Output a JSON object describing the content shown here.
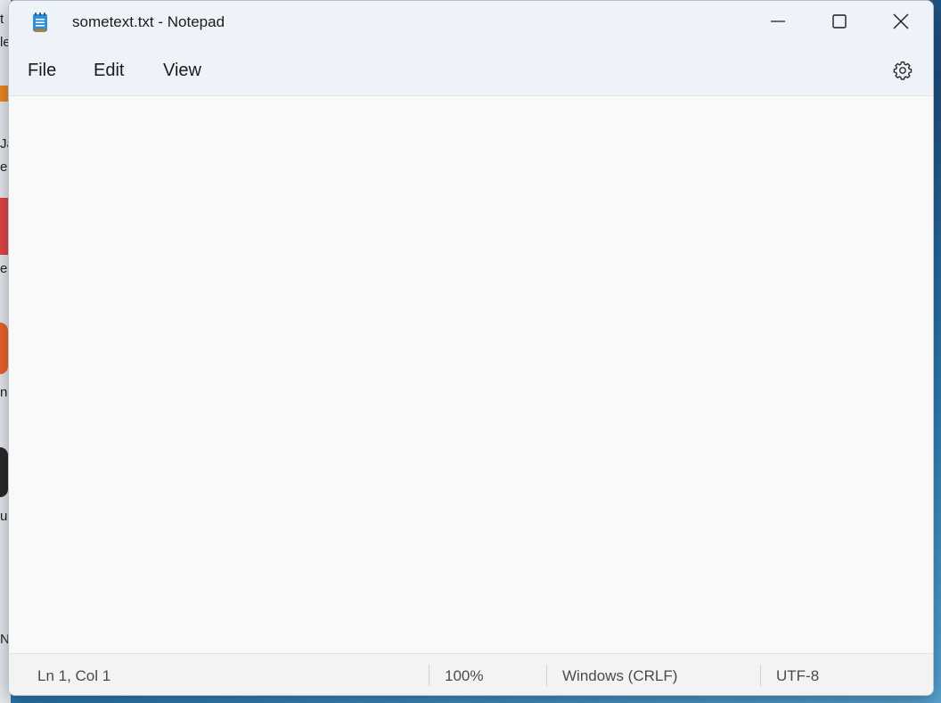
{
  "window": {
    "title": "sometext.txt - Notepad",
    "app_icon": "notepad-icon"
  },
  "controls": {
    "minimize_icon": "minimize-icon",
    "maximize_icon": "maximize-icon",
    "close_icon": "close-icon"
  },
  "menu": {
    "items": [
      {
        "label": "File"
      },
      {
        "label": "Edit"
      },
      {
        "label": "View"
      }
    ],
    "settings_icon": "gear-icon"
  },
  "editor": {
    "content": ""
  },
  "status": {
    "position": "Ln 1, Col 1",
    "zoom": "100%",
    "line_ending": "Windows (CRLF)",
    "encoding": "UTF-8"
  },
  "desktop": {
    "fragments": [
      "t",
      "le",
      "Ja",
      "er",
      "e",
      "n",
      "u",
      "N"
    ]
  },
  "colors": {
    "titlebar_bg": "#eef3f9",
    "editor_bg": "#f9f9f9",
    "statusbar_bg": "#f3f3f3",
    "desktop_bg": "#2f6f9f"
  }
}
